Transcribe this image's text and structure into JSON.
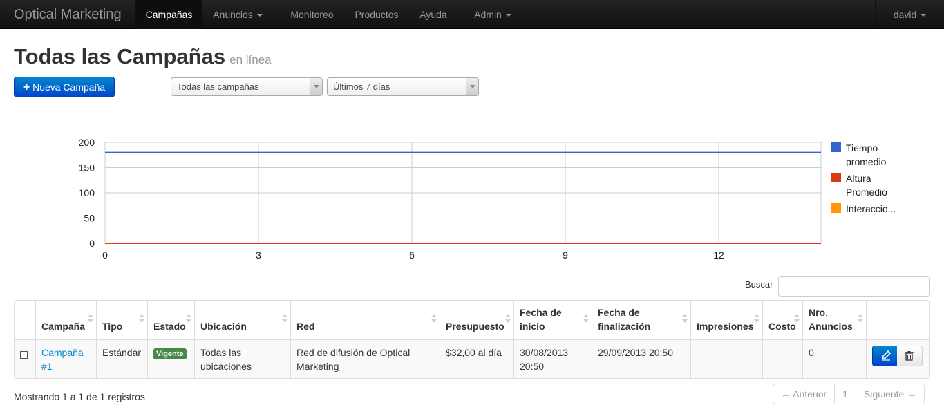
{
  "navbar": {
    "brand": "Optical Marketing",
    "items": [
      {
        "label": "Campañas",
        "active": true
      },
      {
        "label": "Anuncios",
        "dropdown": true
      },
      {
        "label": "Monitoreo"
      },
      {
        "label": "Productos"
      },
      {
        "label": "Ayuda"
      },
      {
        "label": "Admin",
        "dropdown": true
      }
    ],
    "user": "david"
  },
  "header": {
    "title": "Todas las Campañas",
    "subtitle": "en línea"
  },
  "toolbar": {
    "new_button": "Nueva Campaña",
    "campaign_filter": "Todas las campañas",
    "date_filter": "Últimos 7 días"
  },
  "chart_data": {
    "type": "line",
    "x": [
      0,
      3,
      6,
      9,
      12
    ],
    "xlim": [
      0,
      14
    ],
    "ylim": [
      0,
      200
    ],
    "y_ticks": [
      0,
      50,
      100,
      150,
      200
    ],
    "x_ticks": [
      0,
      3,
      6,
      9,
      12
    ],
    "grid": true,
    "legend_position": "right",
    "series": [
      {
        "name": "Tiempo promedio",
        "color": "#3366cc",
        "values": [
          180,
          180,
          180,
          180,
          180
        ]
      },
      {
        "name": "Altura Promedio",
        "color": "#dc3912",
        "values": [
          0,
          0,
          0,
          0,
          0
        ]
      },
      {
        "name": "Interaccio...",
        "color": "#ff9900",
        "values": [
          0,
          0,
          0,
          0,
          0
        ]
      }
    ]
  },
  "search": {
    "label": "Buscar",
    "value": ""
  },
  "table": {
    "headers": [
      "Campaña",
      "Tipo",
      "Estado",
      "Ubicación",
      "Red",
      "Presupuesto",
      "Fecha de inicio",
      "Fecha de finalización",
      "Impresiones",
      "Costo",
      "Nro. Anuncios"
    ],
    "rows": [
      {
        "campaign": "Campaña #1",
        "type": "Estándar",
        "status": "Vigente",
        "location": "Todas las ubicaciones",
        "network": "Red de difusión de Optical Marketing",
        "budget": "$32,00 al día",
        "start": "30/08/2013 20:50",
        "end": "29/09/2013 20:50",
        "impressions": "",
        "cost": "",
        "ads": "0"
      }
    ]
  },
  "footer": {
    "info": "Mostrando 1 a 1 de 1 registros",
    "prev": "← Anterior",
    "page": "1",
    "next": "Siguiente →"
  },
  "colors": {
    "primary": "#0055cc",
    "success": "#468847",
    "link": "#0088cc",
    "navbar": "#1b1b1b"
  }
}
